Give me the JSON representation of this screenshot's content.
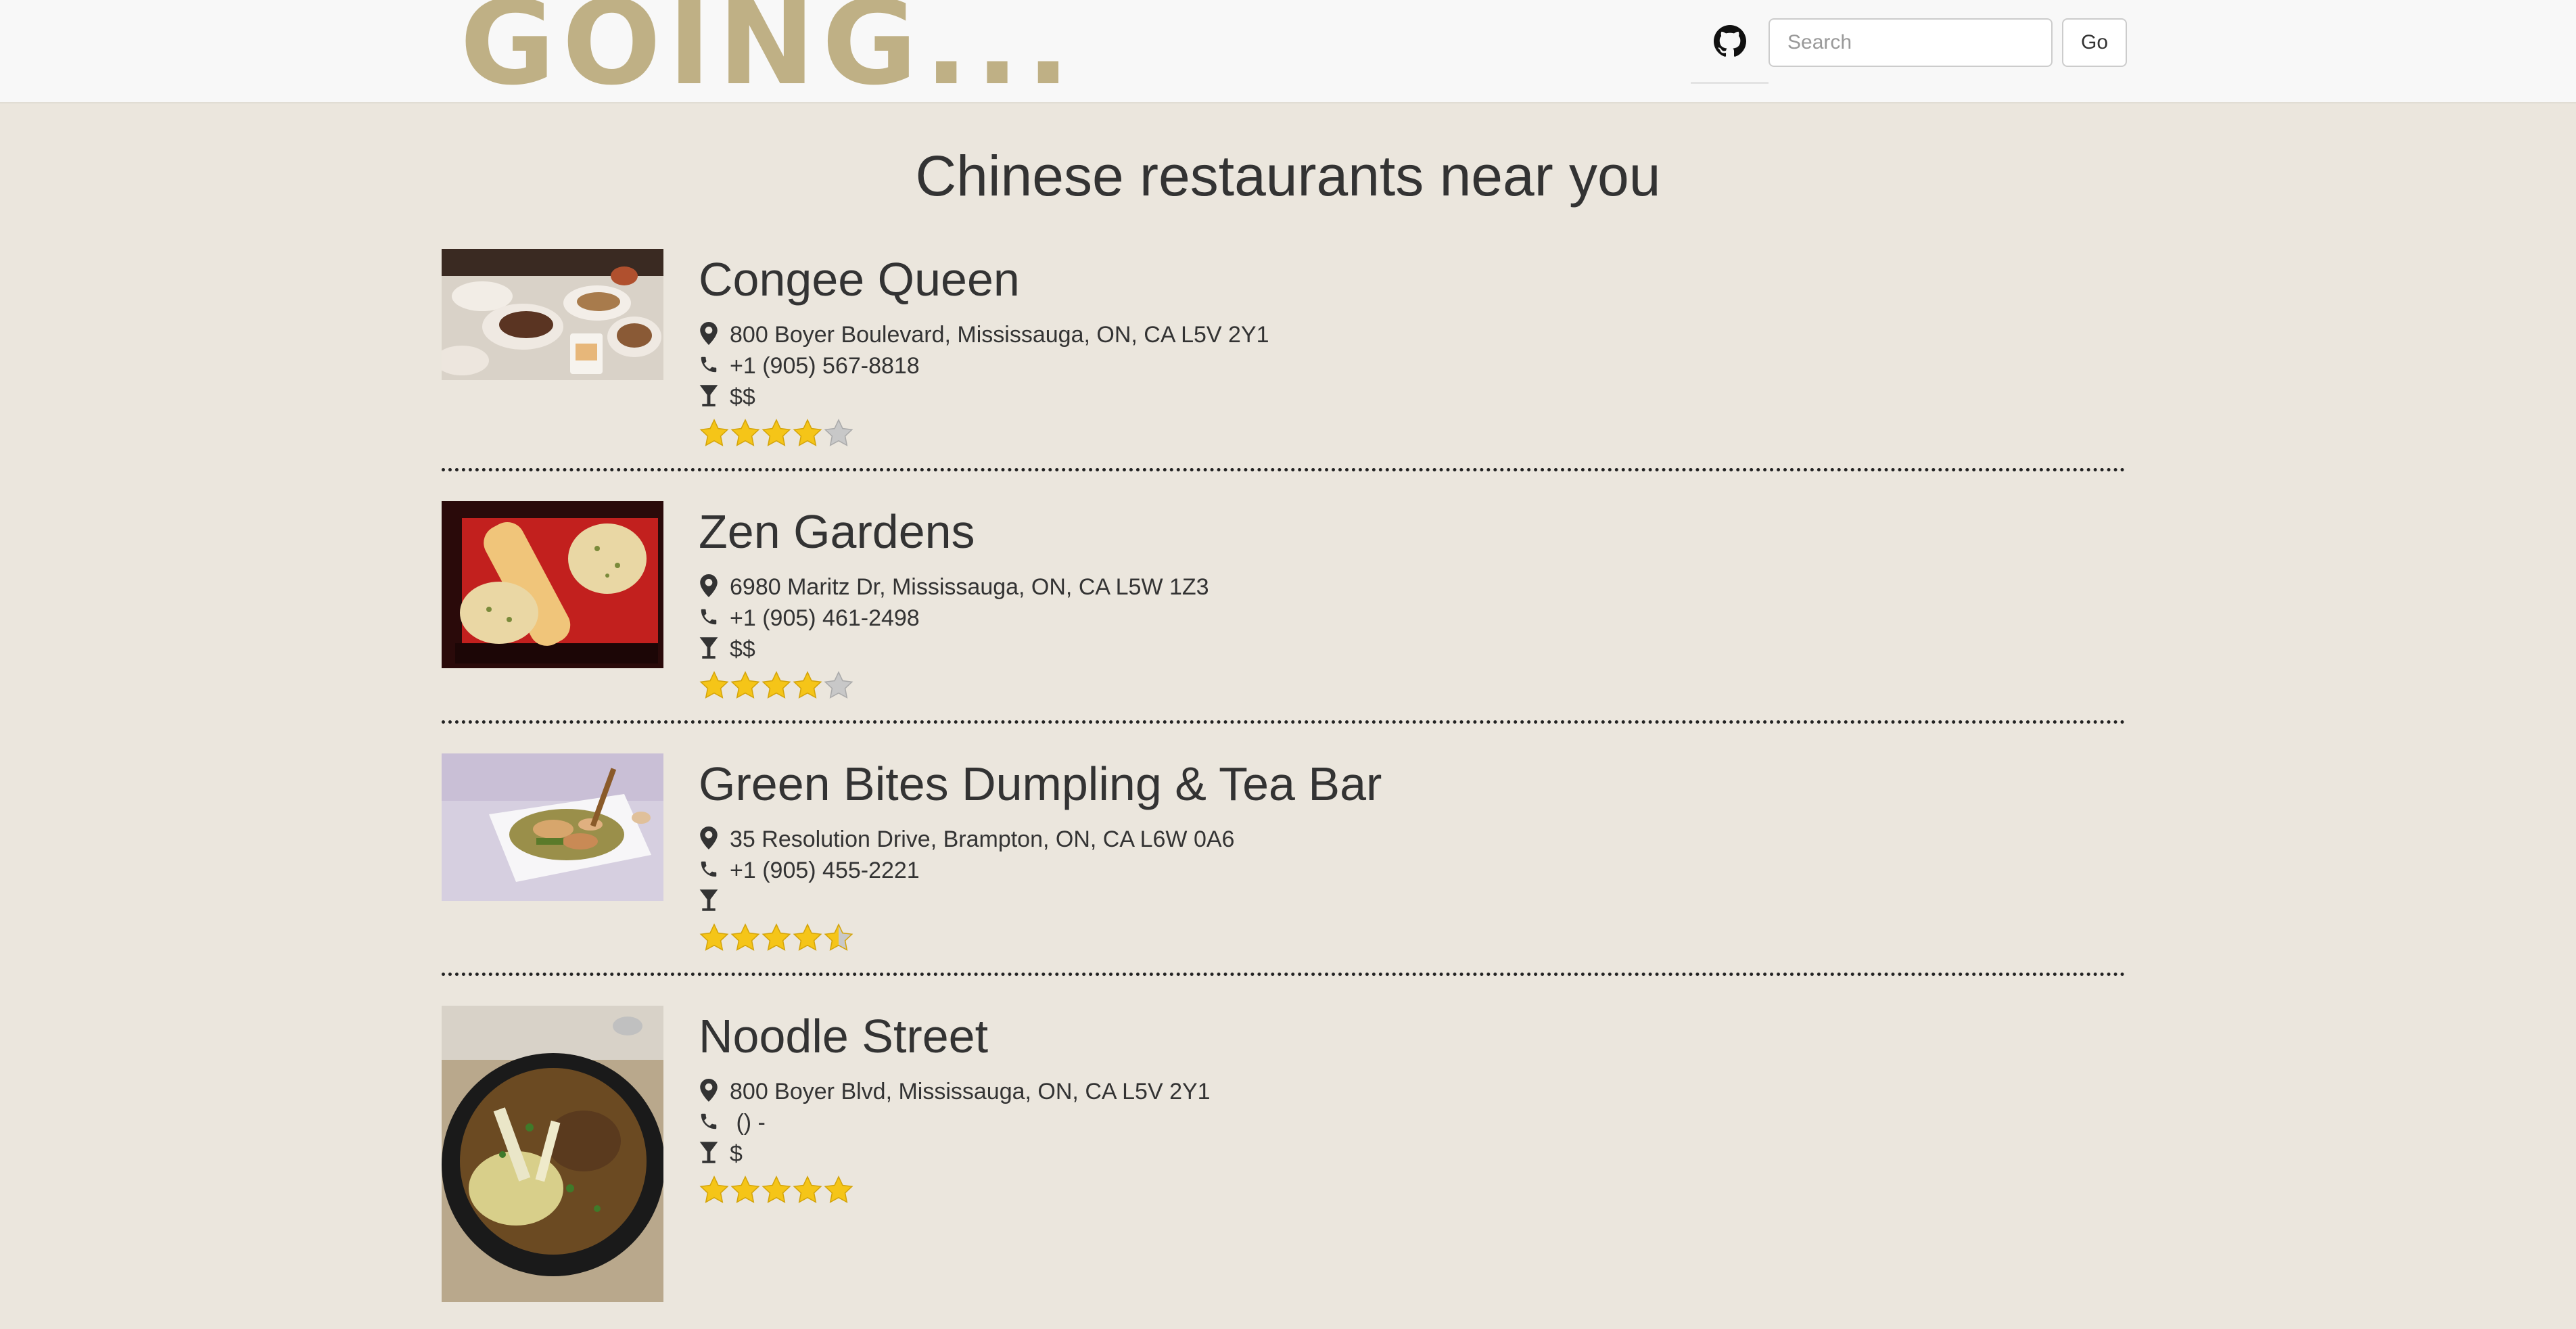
{
  "nav": {
    "brand": "GOING...",
    "search_placeholder": "Search",
    "go_label": "Go"
  },
  "page": {
    "heading": "Chinese restaurants near you"
  },
  "restaurants": [
    {
      "name": "Congee Queen",
      "address": "800 Boyer Boulevard, Mississauga, ON, CA L5V 2Y1",
      "phone": "+1 (905) 567-8818",
      "price": "$$",
      "rating": 4
    },
    {
      "name": "Zen Gardens",
      "address": "6980 Maritz Dr, Mississauga, ON, CA L5W 1Z3",
      "phone": "+1 (905) 461-2498",
      "price": "$$",
      "rating": 4
    },
    {
      "name": "Green Bites Dumpling & Tea Bar",
      "address": "35 Resolution Drive, Brampton, ON, CA L6W 0A6",
      "phone": "+1 (905) 455-2221",
      "price": "",
      "rating": 4.5
    },
    {
      "name": "Noodle Street",
      "address": "800 Boyer Blvd, Mississauga, ON, CA L5V 2Y1",
      "phone": " () -",
      "price": "$",
      "rating": 5
    }
  ],
  "icons": {
    "github": "github-icon",
    "address": "map-marker-icon",
    "phone": "phone-icon",
    "price": "cocktail-glass-icon",
    "star": "star-icon"
  },
  "colors": {
    "brand": "#bfb085",
    "background": "#ebe6dd",
    "star_filled": "#f5c518",
    "star_empty": "#c8c8c8"
  }
}
